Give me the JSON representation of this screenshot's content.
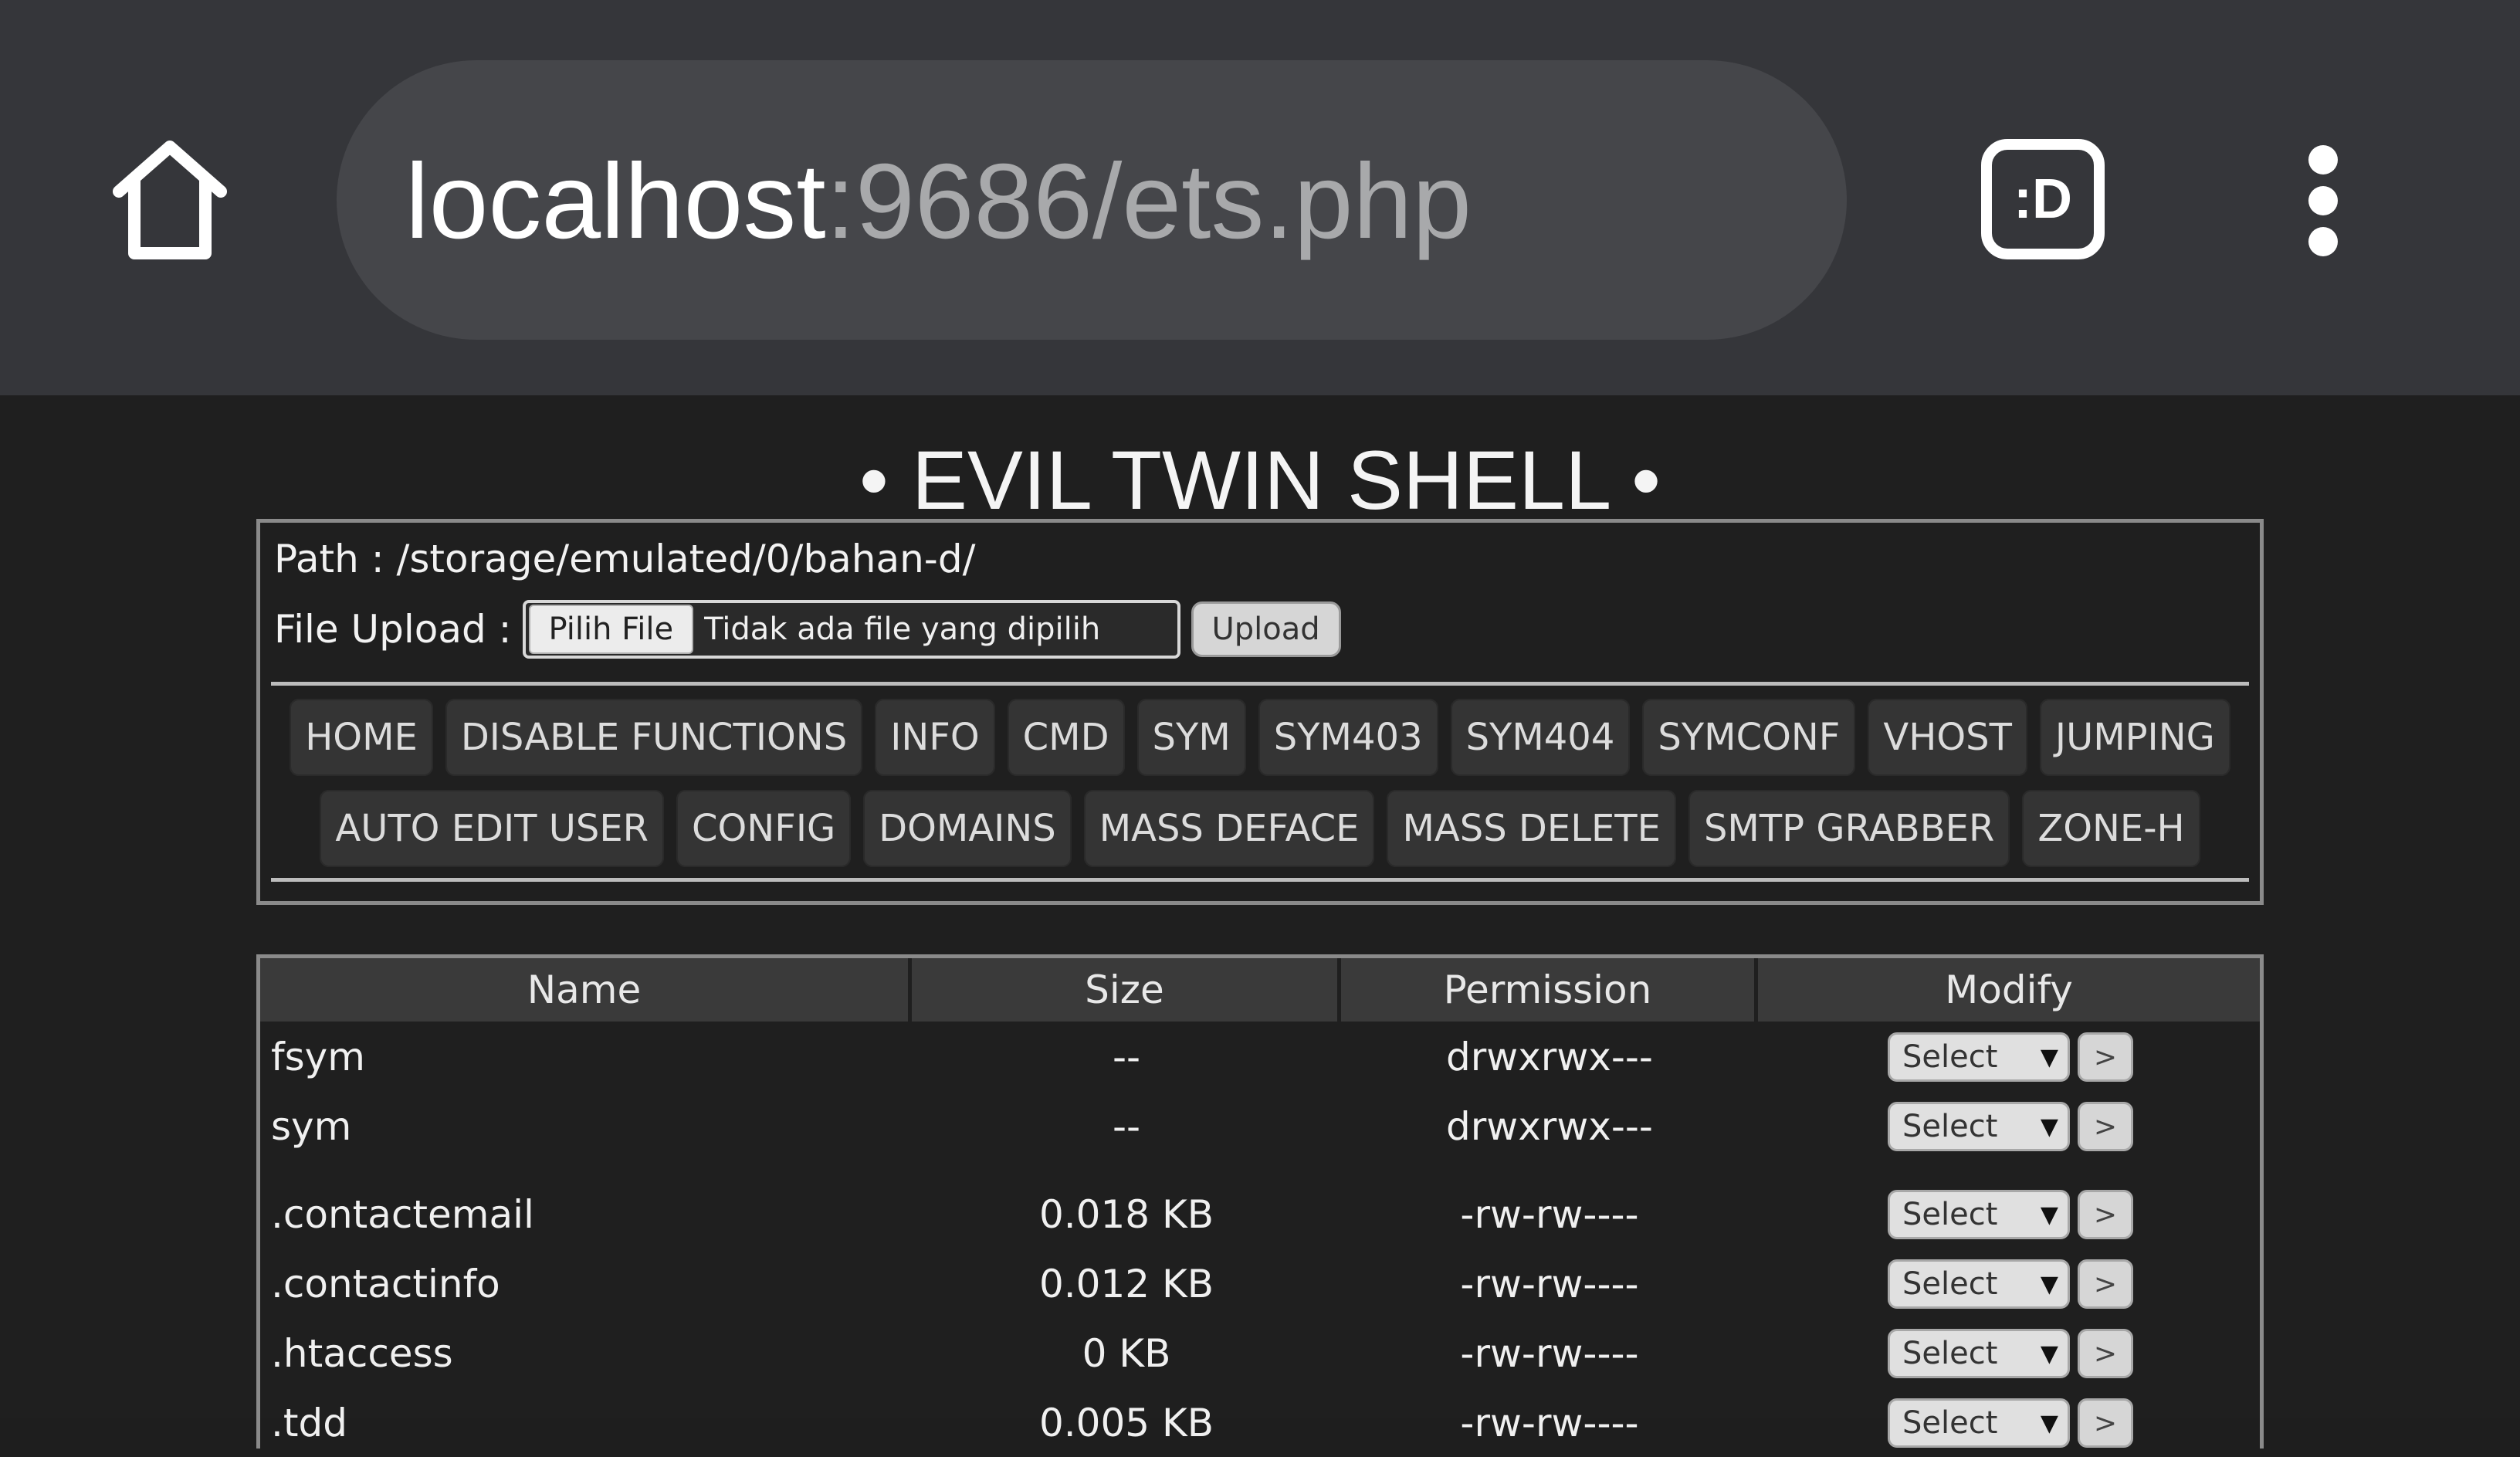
{
  "browser": {
    "url_host": "localhost",
    "url_rest": ":9686/ets.php",
    "tab_label": ":D",
    "home_icon": "home-icon",
    "menu_icon": "more-vert-icon"
  },
  "page": {
    "title": "• EVIL TWIN SHELL •",
    "path_label": "Path : /storage/emulated/0/bahan-d/",
    "upload_label": "File Upload :",
    "pick_file": "Pilih File",
    "file_status": "Tidak ada file yang dipilih",
    "upload_button": "Upload"
  },
  "nav": {
    "row1": [
      "HOME",
      "DISABLE FUNCTIONS",
      "INFO",
      "CMD",
      "SYM",
      "SYM403",
      "SYM404",
      "SYMCONF",
      "VHOST",
      "JUMPING"
    ],
    "row2": [
      "AUTO EDIT USER",
      "CONFIG",
      "DOMAINS",
      "MASS DEFACE",
      "MASS DELETE",
      "SMTP GRABBER",
      "ZONE-H"
    ]
  },
  "table": {
    "headers": [
      "Name",
      "Size",
      "Permission",
      "Modify"
    ],
    "select_label": "Select",
    "go_label": ">",
    "rows": [
      {
        "name": "fsym",
        "size": "--",
        "perm": "drwxrwx---"
      },
      {
        "name": "sym",
        "size": "--",
        "perm": "drwxrwx---"
      },
      {
        "name": ".contactemail",
        "size": "0.018 KB",
        "perm": "-rw-rw----"
      },
      {
        "name": ".contactinfo",
        "size": "0.012 KB",
        "perm": "-rw-rw----"
      },
      {
        "name": ".htaccess",
        "size": "0 KB",
        "perm": "-rw-rw----"
      },
      {
        "name": ".tdd",
        "size": "0.005 KB",
        "perm": "-rw-rw----"
      }
    ]
  }
}
